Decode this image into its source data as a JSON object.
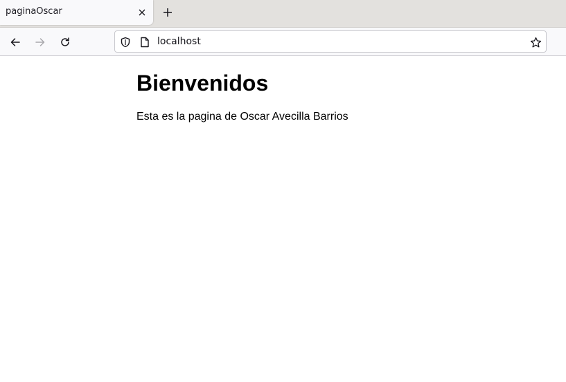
{
  "tab": {
    "title": "paginaOscar",
    "close_icon": "close-icon",
    "new_tab_icon": "plus-icon"
  },
  "navigation": {
    "back_icon": "arrow-left-icon",
    "forward_icon": "arrow-right-icon",
    "forward_enabled": false,
    "reload_icon": "reload-icon"
  },
  "urlbar": {
    "value": "localhost",
    "shield_icon": "shield-icon",
    "page_icon": "page-icon",
    "bookmark_icon": "star-icon"
  },
  "page": {
    "heading": "Bienvenidos",
    "text": "Esta es la pagina de Oscar Avecilla Barrios"
  },
  "colors": {
    "tabbar_bg": "#e3e1de",
    "toolbar_bg": "#f9f9fb",
    "icon": "#15141a",
    "icon_disabled": "#a9a8ad"
  }
}
